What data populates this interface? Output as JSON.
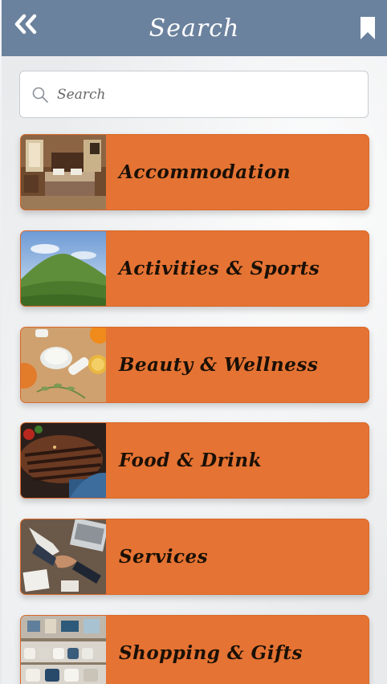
{
  "header": {
    "title": "Search",
    "back_icon": "double-chevron-left-icon",
    "bookmark_icon": "bookmark-icon",
    "color": "#6b829e"
  },
  "search": {
    "placeholder": "Search",
    "value": "",
    "icon": "search-icon"
  },
  "accent_color": "#e57333",
  "categories": [
    {
      "label": "Accommodation",
      "image": "hotel-bedroom"
    },
    {
      "label": "Activities & Sports",
      "image": "green-hills"
    },
    {
      "label": "Beauty & Wellness",
      "image": "spa-products"
    },
    {
      "label": "Food & Drink",
      "image": "grilled-steak"
    },
    {
      "label": "Services",
      "image": "business-handshake"
    },
    {
      "label": "Shopping & Gifts",
      "image": "gift-shop-shelves"
    }
  ]
}
